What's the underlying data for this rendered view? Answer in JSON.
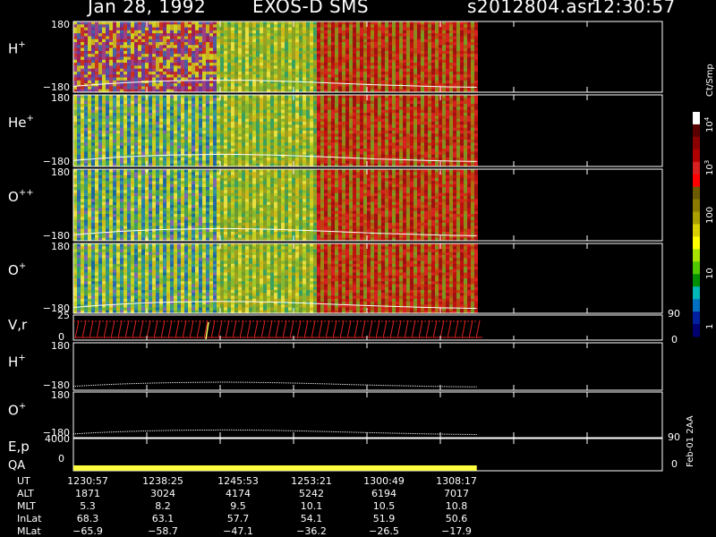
{
  "header": {
    "date": "Jan 28, 1992",
    "instrument": "EXOS-D SMS",
    "file": "s2012804.asr",
    "time": "12:30:57"
  },
  "chart_data": {
    "type": "heatmap",
    "panels": [
      {
        "id": "h_plus",
        "label": "H",
        "sup": "+",
        "ytop": "180",
        "ybot": "−180",
        "ylim": [
          -180,
          180
        ]
      },
      {
        "id": "he_plus",
        "label": "He",
        "sup": "+",
        "ytop": "180",
        "ybot": "−180",
        "ylim": [
          -180,
          180
        ]
      },
      {
        "id": "o_pp",
        "label": "O",
        "sup": "++",
        "ytop": "180",
        "ybot": "−180",
        "ylim": [
          -180,
          180
        ]
      },
      {
        "id": "o_plus",
        "label": "O",
        "sup": "+",
        "ytop": "180",
        "ybot": "−180",
        "ylim": [
          -180,
          180
        ]
      }
    ],
    "vr_panel": {
      "label": "V,r",
      "left_ticks": [
        "25",
        "0"
      ],
      "right_ticks": [
        "90",
        "0"
      ]
    },
    "h_line_panel": {
      "label": "H",
      "sup": "+",
      "ytop": "180",
      "ybot": "−180"
    },
    "o_line_panel": {
      "label": "O",
      "sup": "+",
      "ytop": "180",
      "ybot": "−180"
    },
    "ep_panel": {
      "label1": "E,p",
      "label2": "QA",
      "left_ticks": [
        "4000",
        "0"
      ],
      "right_ticks": [
        "90",
        "0"
      ]
    },
    "colorbar": {
      "unit": "Ct/Smp",
      "ticks": [
        "10",
        "1",
        "100",
        "10",
        "10"
      ],
      "tick_sups": [
        "4",
        "3"
      ],
      "colors": [
        "#ffffff",
        "#5a0000",
        "#8b0000",
        "#b00000",
        "#d82020",
        "#ff0000",
        "#6b5a00",
        "#8a7a00",
        "#aaa000",
        "#d8d000",
        "#ffff00",
        "#a8e000",
        "#50c800",
        "#009000",
        "#00b8b8",
        "#0070c0",
        "#0020a0",
        "#000070"
      ]
    },
    "time_ticks": [
      "1230:57",
      "1238:25",
      "1245:53",
      "1253:21",
      "1300:49",
      "1308:17"
    ],
    "data_extent_fraction": 0.685,
    "trace_white": [
      -150,
      -140,
      -132,
      -126,
      -122,
      -120,
      -119,
      -120,
      -123,
      -127,
      -132,
      -137,
      -142,
      -146,
      -150,
      -153,
      -155
    ],
    "orbit": {
      "rows": [
        {
          "name": "UT",
          "values": [
            "1230:57",
            "1238:25",
            "1245:53",
            "1253:21",
            "1300:49",
            "1308:17"
          ]
        },
        {
          "name": "ALT",
          "values": [
            "1871",
            "3024",
            "4174",
            "5242",
            "6194",
            "7017"
          ]
        },
        {
          "name": "MLT",
          "values": [
            "5.3",
            "8.2",
            "9.5",
            "10.1",
            "10.5",
            "10.8"
          ]
        },
        {
          "name": "InLat",
          "values": [
            "68.3",
            "63.1",
            "57.7",
            "54.1",
            "51.9",
            "50.6"
          ]
        },
        {
          "name": "MLat",
          "values": [
            "−65.9",
            "−58.7",
            "−47.1",
            "−36.2",
            "−26.5",
            "−17.9"
          ]
        }
      ]
    }
  },
  "side_note": "Feb-01 2AA"
}
